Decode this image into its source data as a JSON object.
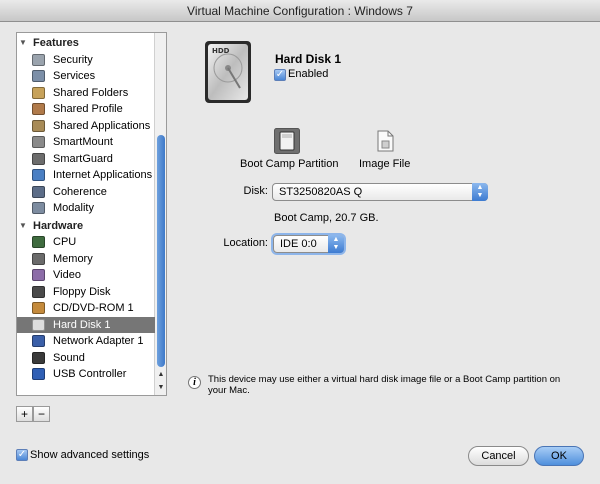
{
  "window": {
    "title": "Virtual Machine Configuration : Windows 7"
  },
  "sidebar": {
    "sections": [
      {
        "label": "Features",
        "items": [
          {
            "label": "Security",
            "icon": "shield-icon",
            "color": "#9aa3ad"
          },
          {
            "label": "Services",
            "icon": "services-icon",
            "color": "#7c8fa8"
          },
          {
            "label": "Shared Folders",
            "icon": "shared-folders-icon",
            "color": "#c7a25a"
          },
          {
            "label": "Shared Profile",
            "icon": "shared-profile-icon",
            "color": "#b07a4a"
          },
          {
            "label": "Shared Applications",
            "icon": "shared-applications-icon",
            "color": "#a88b57"
          },
          {
            "label": "SmartMount",
            "icon": "smartmount-icon",
            "color": "#8a8a8a"
          },
          {
            "label": "SmartGuard",
            "icon": "smartguard-icon",
            "color": "#6c6c6c"
          },
          {
            "label": "Internet Applications",
            "icon": "internet-applications-icon",
            "color": "#4a7fc3"
          },
          {
            "label": "Coherence",
            "icon": "coherence-icon",
            "color": "#5c6d88"
          },
          {
            "label": "Modality",
            "icon": "modality-icon",
            "color": "#7d8ca0"
          }
        ]
      },
      {
        "label": "Hardware",
        "items": [
          {
            "label": "CPU",
            "icon": "cpu-icon",
            "color": "#3f6b3f"
          },
          {
            "label": "Memory",
            "icon": "memory-icon",
            "color": "#6a6a6a"
          },
          {
            "label": "Video",
            "icon": "video-icon",
            "color": "#8c6ca8"
          },
          {
            "label": "Floppy Disk",
            "icon": "floppy-disk-icon",
            "color": "#4a4a4a"
          },
          {
            "label": "CD/DVD-ROM 1",
            "icon": "cd-dvd-icon",
            "color": "#c48a3c"
          },
          {
            "label": "Hard Disk 1",
            "icon": "hard-disk-icon",
            "color": "#dddddd",
            "selected": true
          },
          {
            "label": "Network Adapter 1",
            "icon": "network-adapter-icon",
            "color": "#3a5fa8"
          },
          {
            "label": "Sound",
            "icon": "sound-icon",
            "color": "#3a3a3a"
          },
          {
            "label": "USB Controller",
            "icon": "usb-icon",
            "color": "#2f5fb5"
          }
        ]
      }
    ],
    "add_symbol": "+",
    "remove_symbol": "−"
  },
  "device": {
    "title": "Hard Disk 1",
    "enabled_label": "Enabled",
    "enabled": true,
    "hdd_icon_label": "HDD",
    "sources": [
      {
        "label": "Boot Camp Partition",
        "icon": "boot-camp-partition-icon",
        "selected": true
      },
      {
        "label": "Image File",
        "icon": "image-file-icon",
        "selected": false
      }
    ],
    "disk_label": "Disk:",
    "disk_value": "ST3250820AS Q",
    "disk_info": "Boot Camp, 20.7 GB.",
    "location_label": "Location:",
    "location_value": "IDE 0:0",
    "info_text": "This device may use either a virtual hard disk image file or a Boot Camp partition on your Mac."
  },
  "footer": {
    "show_advanced_label": "Show advanced settings",
    "show_advanced_checked": true,
    "cancel_label": "Cancel",
    "ok_label": "OK"
  },
  "colors": {
    "accent": "#3d7bd1",
    "selection": "#767676"
  }
}
